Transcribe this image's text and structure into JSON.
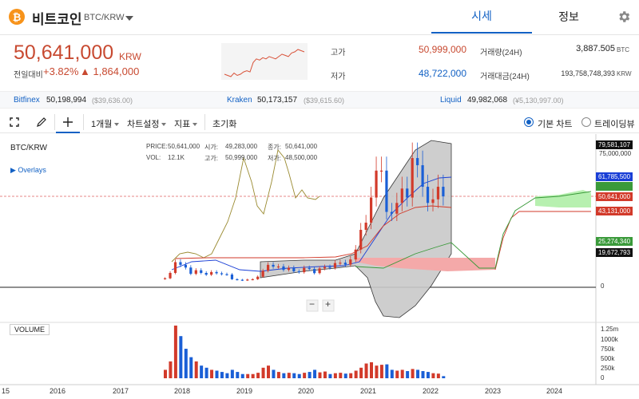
{
  "header": {
    "coin_name": "비트코인",
    "pair": "BTC/KRW",
    "tab_quote": "시세",
    "tab_info": "정보"
  },
  "price": {
    "current": "50,641,000",
    "unit": "KRW",
    "change_label": "전일대비",
    "change_pct": "+3.82%",
    "change_abs": "▲ 1,864,000",
    "sparkline": [
      45,
      44,
      43,
      46,
      44,
      45,
      47,
      48,
      47,
      55,
      58,
      57,
      59,
      58,
      60,
      59,
      58,
      60,
      62,
      61,
      60,
      63,
      64,
      66,
      65,
      64
    ]
  },
  "stats": {
    "high_label": "고가",
    "high": "50,999,000",
    "low_label": "저가",
    "low": "48,722,000",
    "volume_label": "거래량(24H)",
    "volume": "3,887.505",
    "volume_unit": "BTC",
    "amount_label": "거래대금(24H)",
    "amount": "193,758,748,393",
    "amount_unit": "KRW"
  },
  "exchanges": [
    {
      "name": "Bitfinex",
      "price": "50,198,994",
      "usd": "($39,636.00)"
    },
    {
      "name": "Kraken",
      "price": "50,173,157",
      "usd": "($39,615.60)"
    },
    {
      "name": "Liquid",
      "price": "49,982,068",
      "usd": "(¥5,130,997.00)"
    }
  ],
  "toolbar": {
    "period": "1개월",
    "chart_settings": "차트설정",
    "indicators": "지표",
    "reset": "초기화",
    "basic_chart": "기본 차트",
    "trading_view": "트레이딩뷰"
  },
  "chart": {
    "symbol": "BTC/KRW",
    "overlays": "Overlays",
    "legend": {
      "price_k": "PRICE:",
      "price_v": "50,641,000",
      "open_k": "시가:",
      "open_v": "49,283,000",
      "close_k": "종가:",
      "close_v": "50,641,000",
      "vol_k": "VOL:",
      "vol_v": "12.1K",
      "high_k": "고가:",
      "high_v": "50,999,000",
      "low_k": "저가:",
      "low_v": "48,500,000"
    },
    "axis_tags": [
      {
        "label": "79,581,107",
        "color": "#111111"
      },
      {
        "label": "61,785,500",
        "color": "#1a3fd6"
      },
      {
        "label": "50,641,000",
        "color": "#d23a2a"
      },
      {
        "label": "43,131,000",
        "color": "#d23a2a"
      },
      {
        "label": "25,274,340",
        "color": "#3a9a3a"
      },
      {
        "label": "19,672,793",
        "color": "#111111"
      }
    ],
    "axis_top_tick": "75,000,000",
    "axis_zero": "0",
    "volume_label": "VOLUME",
    "volume_ticks": [
      "1.25m",
      "1000k",
      "750k",
      "500k",
      "250k",
      "0"
    ],
    "years": [
      "15",
      "2016",
      "2017",
      "2018",
      "2019",
      "2020",
      "2021",
      "2022",
      "2023",
      "2024"
    ]
  },
  "chart_data": {
    "type": "candlestick",
    "title": "",
    "ylabel": "",
    "ylim": [
      0,
      80000000
    ],
    "x": [
      "2017-10",
      "2017-11",
      "2017-12",
      "2018-01",
      "2018-02",
      "2018-03",
      "2018-04",
      "2018-05",
      "2018-06",
      "2018-07",
      "2018-08",
      "2018-09",
      "2018-10",
      "2018-11",
      "2018-12",
      "2019-01",
      "2019-02",
      "2019-03",
      "2019-04",
      "2019-05",
      "2019-06",
      "2019-07",
      "2019-08",
      "2019-09",
      "2019-10",
      "2019-11",
      "2019-12",
      "2020-01",
      "2020-02",
      "2020-03",
      "2020-04",
      "2020-05",
      "2020-06",
      "2020-07",
      "2020-08",
      "2020-09",
      "2020-10",
      "2020-11",
      "2020-12",
      "2021-01",
      "2021-02",
      "2021-03",
      "2021-04",
      "2021-05",
      "2021-06",
      "2021-07",
      "2021-08",
      "2021-09",
      "2021-10",
      "2021-11",
      "2021-12",
      "2022-01",
      "2022-02",
      "2022-03",
      "2022-04"
    ],
    "series": [
      {
        "values_close": [
          5000000,
          8000000,
          14000000,
          12500000,
          11000000,
          7500000,
          9500000,
          8000000,
          7000000,
          8500000,
          7800000,
          7300000,
          7100000,
          4500000,
          4200000,
          3900000,
          4300000,
          4500000,
          5900000,
          9200000,
          12500000,
          11500000,
          11600000,
          9700000,
          10800000,
          8900000,
          8400000,
          10800000,
          10200000,
          7900000,
          10500000,
          11300000,
          10900000,
          13500000,
          13700000,
          12600000,
          15500000,
          21000000,
          32000000,
          36000000,
          50000000,
          65000000,
          65000000,
          42000000,
          41000000,
          47000000,
          55000000,
          50000000,
          72000000,
          68000000,
          56000000,
          47000000,
          49000000,
          56000000,
          50641000
        ]
      },
      {
        "values_open": [
          4700000,
          5000000,
          8000000,
          14000000,
          12500000,
          11000000,
          7500000,
          9500000,
          8000000,
          7000000,
          8500000,
          7800000,
          7300000,
          7100000,
          4500000,
          4200000,
          3900000,
          4300000,
          4500000,
          5900000,
          9200000,
          12500000,
          11500000,
          11600000,
          9700000,
          10800000,
          8900000,
          8400000,
          10800000,
          10200000,
          7900000,
          10500000,
          11300000,
          10900000,
          13500000,
          13700000,
          12600000,
          15500000,
          21000000,
          32000000,
          36000000,
          50000000,
          65000000,
          65000000,
          42000000,
          41000000,
          47000000,
          55000000,
          50000000,
          72000000,
          68000000,
          56000000,
          47000000,
          49000000,
          56000000
        ]
      }
    ],
    "volume": [
      200000,
      400000,
      1250000,
      1000000,
      700000,
      500000,
      400000,
      300000,
      250000,
      200000,
      180000,
      150000,
      120000,
      200000,
      150000,
      100000,
      100000,
      100000,
      130000,
      250000,
      300000,
      200000,
      150000,
      120000,
      130000,
      120000,
      100000,
      130000,
      150000,
      200000,
      140000,
      160000,
      100000,
      120000,
      130000,
      110000,
      120000,
      180000,
      250000,
      350000,
      380000,
      300000,
      320000,
      330000,
      200000,
      180000,
      200000,
      170000,
      220000,
      200000,
      170000,
      150000,
      120000,
      110000,
      50000
    ]
  }
}
